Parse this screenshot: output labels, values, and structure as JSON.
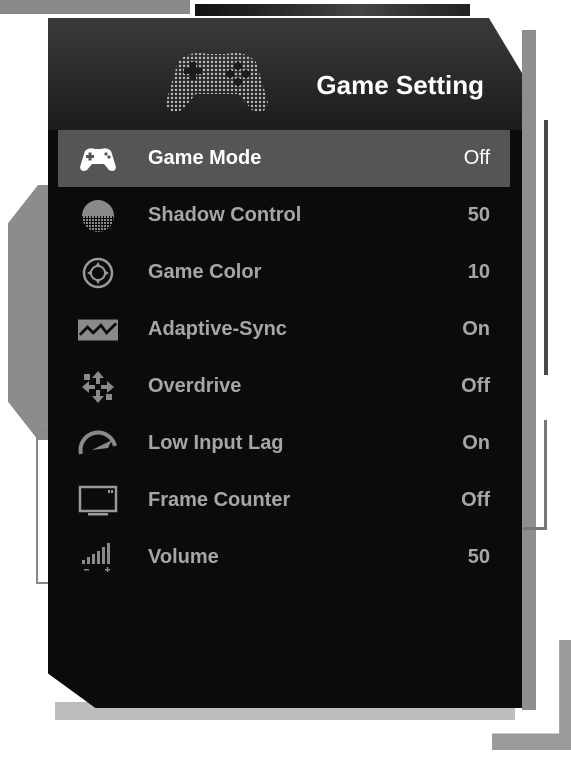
{
  "header": {
    "title": "Game Setting"
  },
  "menu": {
    "items": [
      {
        "label": "Game Mode",
        "value": "Off",
        "icon": "gamepad-icon",
        "selected": true
      },
      {
        "label": "Shadow Control",
        "value": "50",
        "icon": "shadow-icon",
        "selected": false
      },
      {
        "label": "Game Color",
        "value": "10",
        "icon": "crosshair-icon",
        "selected": false
      },
      {
        "label": "Adaptive-Sync",
        "value": "On",
        "icon": "sync-icon",
        "selected": false
      },
      {
        "label": "Overdrive",
        "value": "Off",
        "icon": "overdrive-icon",
        "selected": false
      },
      {
        "label": "Low Input Lag",
        "value": "On",
        "icon": "speedometer-icon",
        "selected": false
      },
      {
        "label": "Frame Counter",
        "value": "Off",
        "icon": "monitor-icon",
        "selected": false
      },
      {
        "label": "Volume",
        "value": "50",
        "icon": "volume-icon",
        "selected": false
      }
    ]
  },
  "colors": {
    "panel": "#0b0b0b",
    "selected_row": "#555555",
    "text_dim": "#a6a6a6",
    "text_active": "#ffffff"
  }
}
